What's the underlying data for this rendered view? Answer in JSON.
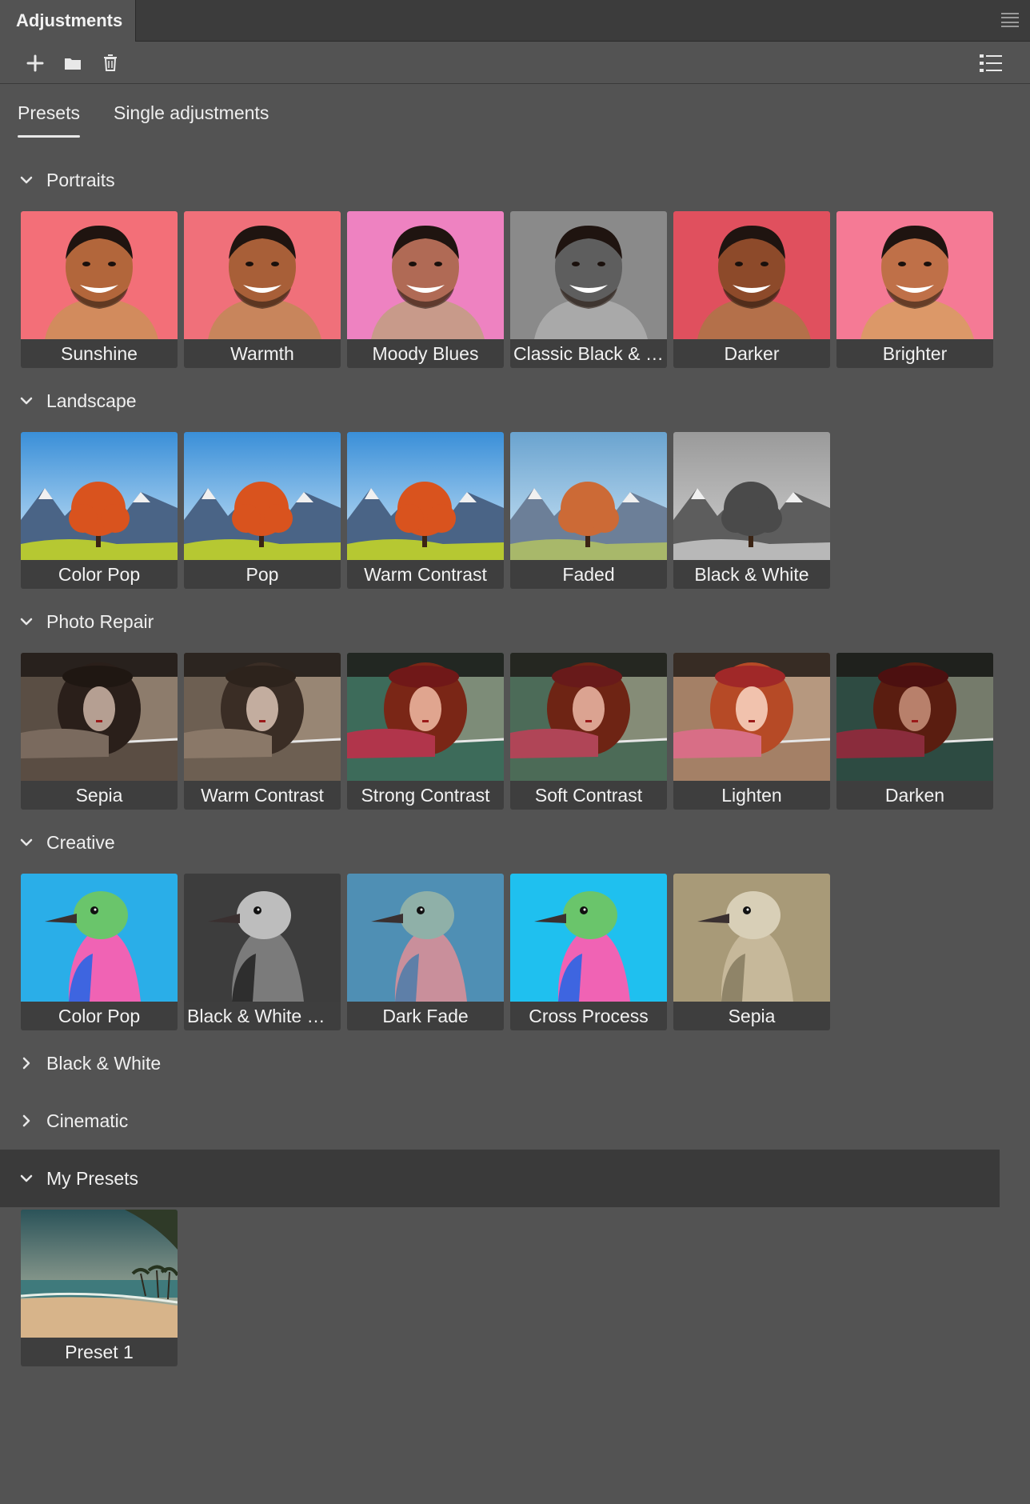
{
  "panel": {
    "title": "Adjustments"
  },
  "toolbar": {
    "add_icon": "plus-icon",
    "folder_icon": "folder-icon",
    "delete_icon": "trash-icon",
    "list_icon": "list-view-icon"
  },
  "tabs": [
    {
      "label": "Presets",
      "active": true
    },
    {
      "label": "Single adjustments",
      "active": false
    }
  ],
  "sections": [
    {
      "title": "Portraits",
      "expanded": true,
      "theme": "portrait",
      "presets": [
        {
          "label": "Sunshine",
          "tone": "warm"
        },
        {
          "label": "Warmth",
          "tone": "warm2"
        },
        {
          "label": "Moody Blues",
          "tone": "pink"
        },
        {
          "label": "Classic Black & W...",
          "tone": "bw"
        },
        {
          "label": "Darker",
          "tone": "dark"
        },
        {
          "label": "Brighter",
          "tone": "bright"
        }
      ]
    },
    {
      "title": "Landscape",
      "expanded": true,
      "theme": "landscape",
      "presets": [
        {
          "label": "Color Pop",
          "tone": "vivid"
        },
        {
          "label": "Pop",
          "tone": "vivid"
        },
        {
          "label": "Warm Contrast",
          "tone": "vivid"
        },
        {
          "label": "Faded",
          "tone": "faded"
        },
        {
          "label": "Black & White",
          "tone": "bw"
        }
      ]
    },
    {
      "title": "Photo Repair",
      "expanded": true,
      "theme": "car",
      "presets": [
        {
          "label": "Sepia",
          "tone": "sepia"
        },
        {
          "label": "Warm Contrast",
          "tone": "sepia2"
        },
        {
          "label": "Strong Contrast",
          "tone": "color"
        },
        {
          "label": "Soft Contrast",
          "tone": "color2"
        },
        {
          "label": "Lighten",
          "tone": "light"
        },
        {
          "label": "Darken",
          "tone": "darkc"
        }
      ]
    },
    {
      "title": "Creative",
      "expanded": true,
      "theme": "bird",
      "presets": [
        {
          "label": "Color Pop",
          "tone": "pop"
        },
        {
          "label": "Black & White Ne...",
          "tone": "bwn"
        },
        {
          "label": "Dark Fade",
          "tone": "fade"
        },
        {
          "label": "Cross Process",
          "tone": "cross"
        },
        {
          "label": "Sepia",
          "tone": "sepia"
        }
      ]
    },
    {
      "title": "Black & White",
      "expanded": false,
      "theme": "",
      "presets": []
    },
    {
      "title": "Cinematic",
      "expanded": false,
      "theme": "",
      "presets": []
    },
    {
      "title": "My Presets",
      "expanded": true,
      "highlight": true,
      "theme": "beach",
      "presets": [
        {
          "label": "Preset 1",
          "tone": "beach"
        }
      ]
    }
  ]
}
